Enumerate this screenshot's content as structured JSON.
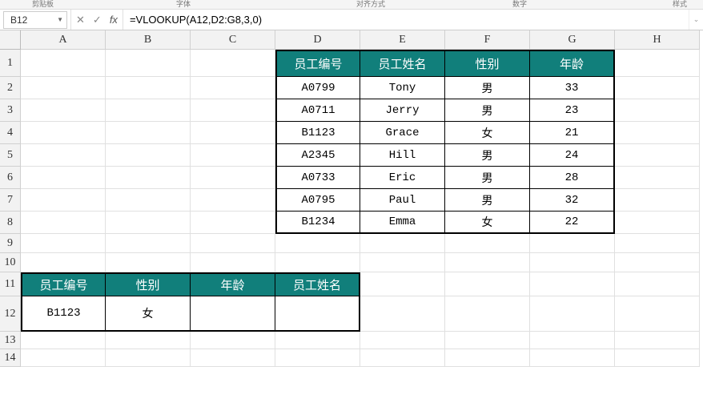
{
  "ribbon_hints": [
    "剪贴板",
    "字体",
    "对齐方式",
    "数字",
    "样式"
  ],
  "formula_bar": {
    "cell_ref": "B12",
    "formula": "=VLOOKUP(A12,D2:G8,3,0)"
  },
  "columns": [
    "A",
    "B",
    "C",
    "D",
    "E",
    "F",
    "G",
    "H"
  ],
  "rows": [
    "1",
    "2",
    "3",
    "4",
    "5",
    "6",
    "7",
    "8",
    "9",
    "10",
    "11",
    "12",
    "13",
    "14"
  ],
  "main_table": {
    "headers": [
      "员工编号",
      "员工姓名",
      "性别",
      "年龄"
    ],
    "rows": [
      {
        "id": "A0799",
        "name": "Tony",
        "gender": "男",
        "age": "33"
      },
      {
        "id": "A0711",
        "name": "Jerry",
        "gender": "男",
        "age": "23"
      },
      {
        "id": "B1123",
        "name": "Grace",
        "gender": "女",
        "age": "21"
      },
      {
        "id": "A2345",
        "name": "Hill",
        "gender": "男",
        "age": "24"
      },
      {
        "id": "A0733",
        "name": "Eric",
        "gender": "男",
        "age": "28"
      },
      {
        "id": "A0795",
        "name": "Paul",
        "gender": "男",
        "age": "32"
      },
      {
        "id": "B1234",
        "name": "Emma",
        "gender": "女",
        "age": "22"
      }
    ]
  },
  "lookup_table": {
    "headers": [
      "员工编号",
      "性别",
      "年龄",
      "员工姓名"
    ],
    "row": {
      "id": "B1123",
      "gender": "女",
      "age": "",
      "name": ""
    }
  }
}
